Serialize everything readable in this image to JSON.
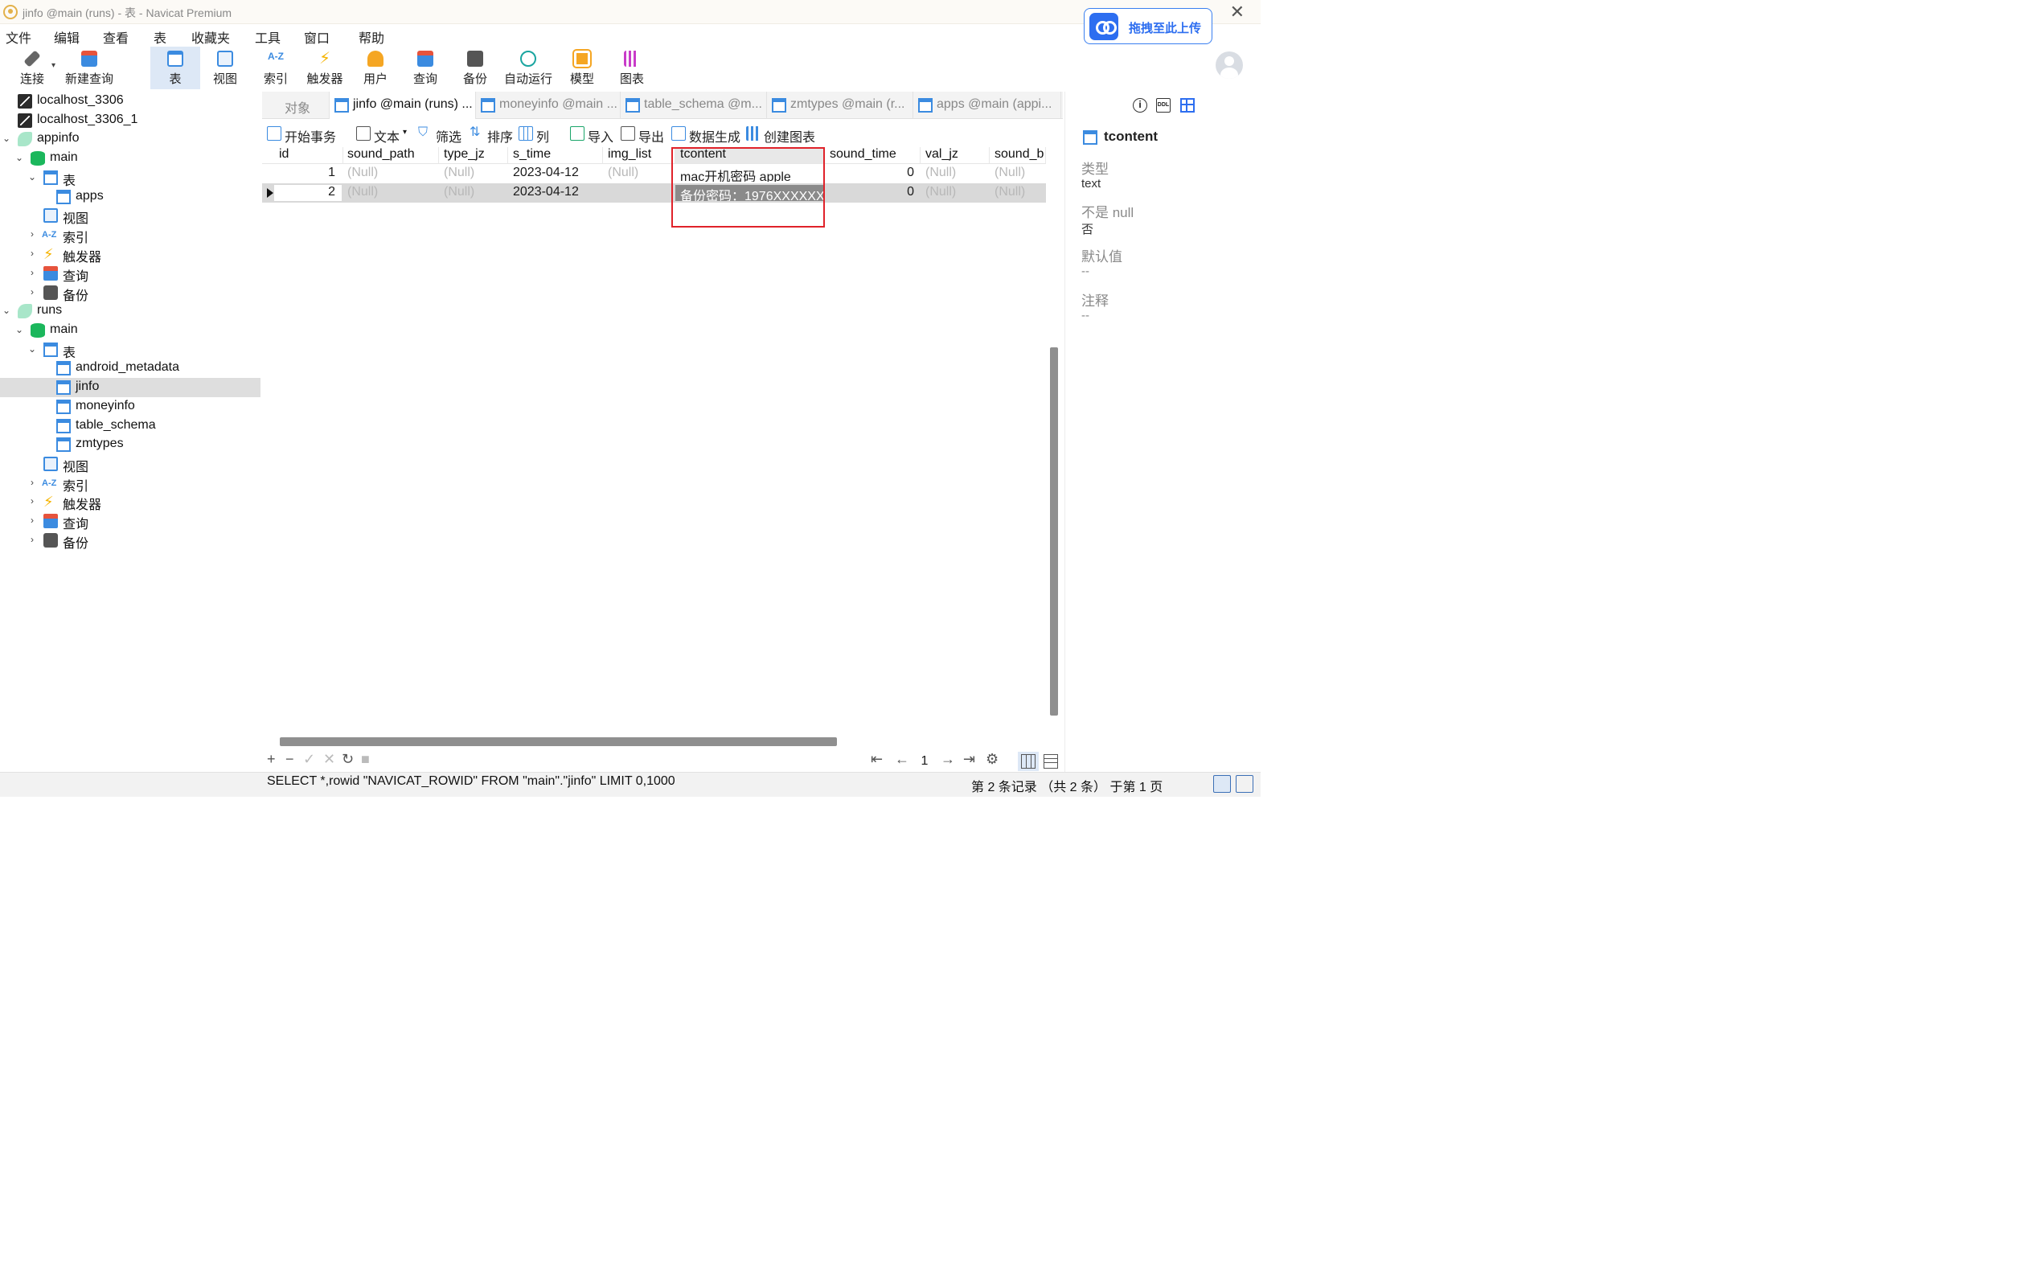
{
  "window": {
    "title": "jinfo @main (runs) - 表 - Navicat Premium",
    "upload_label": "拖拽至此上传"
  },
  "menu": [
    "文件",
    "编辑",
    "查看",
    "表",
    "收藏夹",
    "工具",
    "窗口",
    "帮助"
  ],
  "toolbar": {
    "connect": "连接",
    "new_query": "新建查询",
    "table": "表",
    "view": "视图",
    "index": "索引",
    "trigger": "触发器",
    "user": "用户",
    "query": "查询",
    "backup": "备份",
    "automation": "自动运行",
    "model": "模型",
    "chart": "图表"
  },
  "tree": {
    "conn1": "localhost_3306",
    "conn2": "localhost_3306_1",
    "appinfo": {
      "name": "appinfo",
      "schema": "main",
      "tables_label": "表",
      "tables": [
        "apps"
      ],
      "views": "视图",
      "indexes": "索引",
      "triggers": "触发器",
      "queries": "查询",
      "backups": "备份"
    },
    "runs": {
      "name": "runs",
      "schema": "main",
      "tables_label": "表",
      "tables": [
        "android_metadata",
        "jinfo",
        "moneyinfo",
        "table_schema",
        "zmtypes"
      ],
      "views": "视图",
      "indexes": "索引",
      "triggers": "触发器",
      "queries": "查询",
      "backups": "备份"
    }
  },
  "tabs": {
    "objects": "对象",
    "items": [
      "jinfo @main (runs) ...",
      "moneyinfo @main ...",
      "table_schema @m...",
      "zmtypes @main (r...",
      "apps @main (appi..."
    ]
  },
  "grid_toolbar": {
    "begin_tx": "开始事务",
    "text": "文本",
    "filter": "筛选",
    "sort": "排序",
    "columns": "列",
    "import": "导入",
    "export": "导出",
    "data_gen": "数据生成",
    "create_chart": "创建图表"
  },
  "table": {
    "columns": [
      "id",
      "sound_path",
      "type_jz",
      "s_time",
      "img_list",
      "tcontent",
      "sound_time",
      "val_jz",
      "sound_b"
    ],
    "rows": [
      [
        "1",
        "(Null)",
        "(Null)",
        "2023-04-12",
        "(Null)",
        "mac开机密码 apple",
        "0",
        "(Null)",
        "(Null)"
      ],
      [
        "2",
        "(Null)",
        "(Null)",
        "2023-04-12",
        "",
        "备份密码：1976XXXXXXX",
        "0",
        "(Null)",
        "(Null)"
      ]
    ]
  },
  "pagination": {
    "page": "1"
  },
  "status": {
    "sql": "SELECT *,rowid \"NAVICAT_ROWID\" FROM \"main\".\"jinfo\" LIMIT 0,1000",
    "records": "第 2 条记录 （共 2 条） 于第 1 页"
  },
  "field_panel": {
    "field_name": "tcontent",
    "type_label": "类型",
    "type_value": "text",
    "notnull_label": "不是 null",
    "notnull_value": "否",
    "default_label": "默认值",
    "default_value": "--",
    "comment_label": "注释",
    "comment_value": "--"
  },
  "colors": {
    "accent": "#3b8be0",
    "highlight_box": "#e0222a",
    "selected_row": "#d9d9d9",
    "null_text": "#b8b8b8"
  }
}
